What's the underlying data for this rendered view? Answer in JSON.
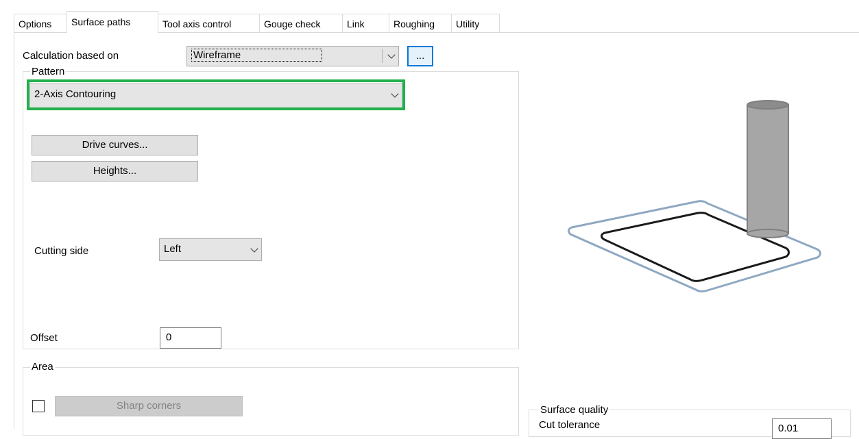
{
  "tabs": [
    {
      "label": "Options"
    },
    {
      "label": "Surface paths"
    },
    {
      "label": "Tool axis control"
    },
    {
      "label": "Gouge check"
    },
    {
      "label": "Link"
    },
    {
      "label": "Roughing"
    },
    {
      "label": "Utility"
    }
  ],
  "active_tab": "Surface paths",
  "calculation": {
    "label": "Calculation based on",
    "value": "Wireframe",
    "browse_label": "..."
  },
  "pattern": {
    "group_title": "Pattern",
    "value": "2-Axis Contouring",
    "highlight_color": "#22b14c",
    "drive_curves_label": "Drive curves...",
    "heights_label": "Heights...",
    "cutting_side_label": "Cutting side",
    "cutting_side_value": "Left",
    "offset_label": "Offset",
    "offset_value": "0"
  },
  "area": {
    "group_title": "Area",
    "sharp_corners_label": "Sharp corners",
    "checked": false
  },
  "surface_quality": {
    "group_title": "Surface quality",
    "cut_tolerance_label": "Cut tolerance",
    "cut_tolerance_value": "0.01"
  },
  "colors": {
    "accent": "#0078d7",
    "tool": "#a6a6a6",
    "plate_outline": "#8fa8c2"
  }
}
